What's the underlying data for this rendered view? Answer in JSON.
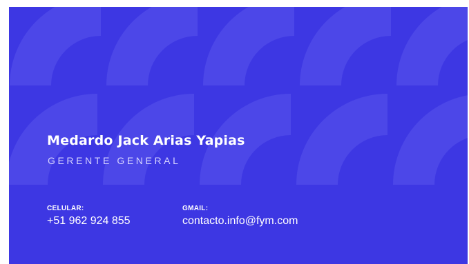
{
  "card": {
    "name": "Medardo Jack Arias Yapias",
    "title": "GERENTE GENERAL",
    "phone_label": "CELULAR:",
    "phone_value": "+51 962 924 855",
    "email_label": "GMAIL:",
    "email_value": "contacto.info@fym.com"
  },
  "colors": {
    "background": "#3d37e3",
    "pattern": "#4c47e8",
    "text": "#ffffff",
    "subtitle": "#d6d4ff"
  }
}
